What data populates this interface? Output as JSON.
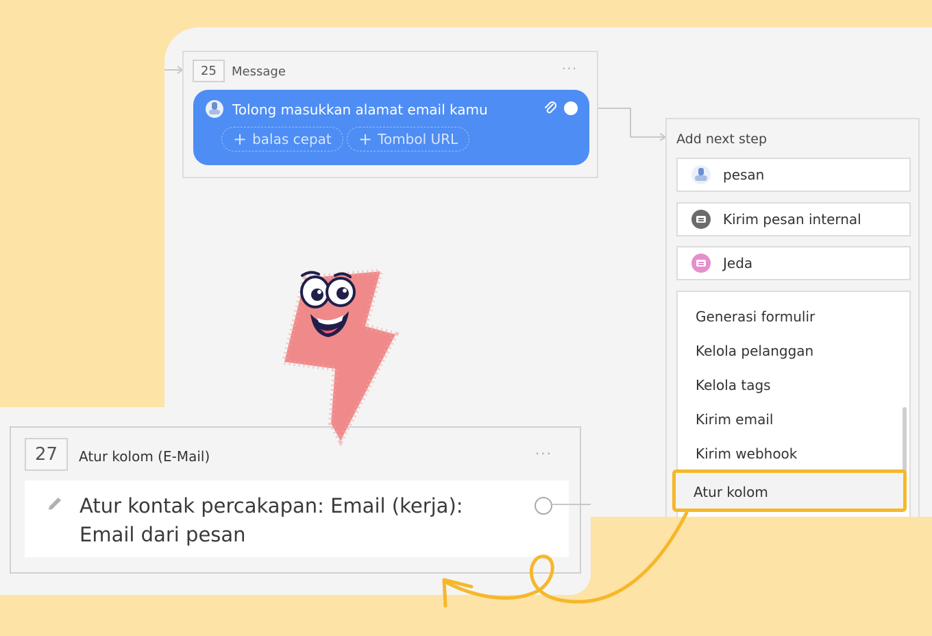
{
  "node_message": {
    "number": "25",
    "title": "Message",
    "menu": "···",
    "text": "Tolong masukkan alamat email kamu",
    "chips": [
      "balas cepat",
      "Tombol URL"
    ],
    "chip_plus": "+"
  },
  "next_step": {
    "title": "Add next step",
    "options": [
      {
        "label": "pesan",
        "icon": "bot-icon"
      },
      {
        "label": "Kirim pesan internal",
        "icon": "internal-message-icon",
        "color": "#6b6b6b"
      },
      {
        "label": "Jeda",
        "icon": "pause-icon",
        "color": "#e58fcc"
      }
    ],
    "dropdown_items": [
      "Generasi formulir",
      "Kelola pelanggan",
      "Kelola tags",
      "Kirim email",
      "Kirim webhook"
    ],
    "highlighted_item": "Atur kolom",
    "highlight_color": "#f6b72a"
  },
  "node_set_field": {
    "number": "27",
    "title": "Atur kolom (E-Mail)",
    "menu": "···",
    "action_line1": "Atur kontak percakapan: Email (kerja):",
    "action_line2": "Email dari pesan"
  },
  "colors": {
    "background": "#fde3a6",
    "canvas": "#f4f4f4",
    "message_bubble": "#4e8df4",
    "accent_arrow": "#f6b72a",
    "mascot": "#f08a8a"
  }
}
